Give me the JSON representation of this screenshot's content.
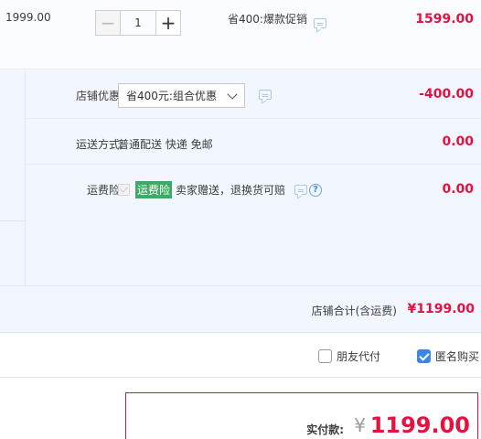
{
  "item": {
    "unit_price": "1999.00",
    "quantity": "1",
    "minus_symbol": "−",
    "plus_symbol": "+",
    "promo_note": "省400:爆款促销",
    "total": "1599.00"
  },
  "shop_options": {
    "discount": {
      "label": "店铺优惠:",
      "selected": "省400元:组合优惠",
      "amount": "-400.00"
    },
    "shipping": {
      "label": "运送方式:",
      "method": "普通配送 快递 免邮",
      "amount": "0.00"
    },
    "insurance": {
      "label": "运费险:",
      "tag": "运费险",
      "desc": "卖家赠送，退换货可赔",
      "help_symbol": "?",
      "amount": "0.00"
    }
  },
  "shop_total": {
    "label": "店铺合计(含运费)",
    "value": "¥1199.00"
  },
  "extra": {
    "friend_pay": "朋友代付",
    "anonymous": "匿名购买"
  },
  "payment": {
    "label": "实付款:",
    "currency": "¥",
    "value": "1199.00"
  },
  "colors": {
    "price_red": "#e4123e",
    "panel_bg": "#f2f7ff",
    "insurance_green": "#3dab64",
    "checkbox_blue": "#3b86e6"
  },
  "icons": [
    "chat-icon",
    "chevron-down-icon",
    "help-icon",
    "check-icon"
  ]
}
